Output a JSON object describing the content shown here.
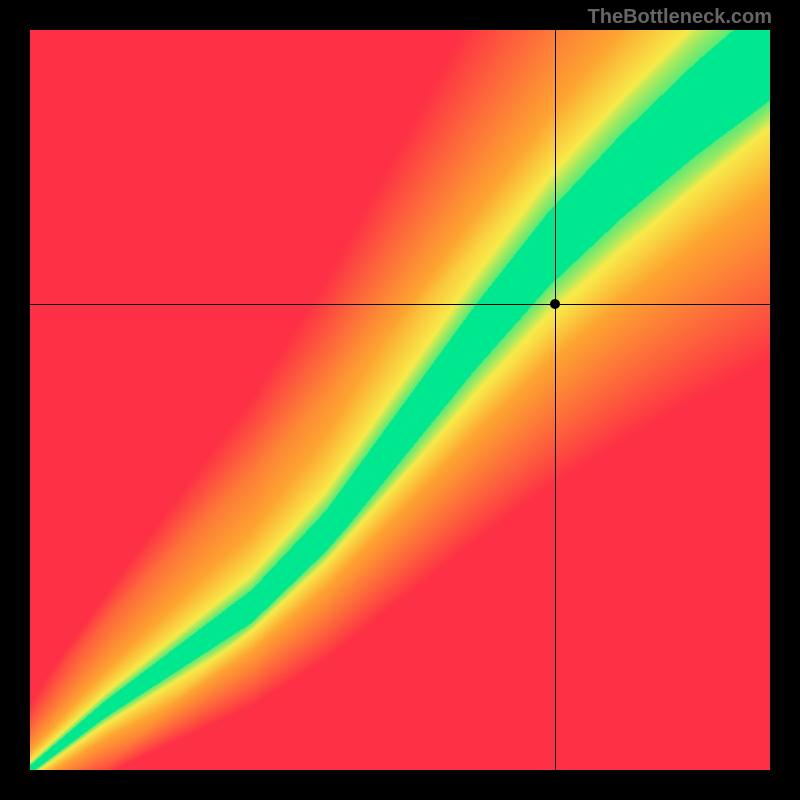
{
  "watermark": "TheBottleneck.com",
  "chart_data": {
    "type": "heatmap",
    "title": "",
    "xlabel": "",
    "ylabel": "",
    "xlim": [
      0,
      100
    ],
    "ylim": [
      0,
      100
    ],
    "crosshair": {
      "x": 71,
      "y": 63
    },
    "marker": {
      "x": 71,
      "y": 63
    },
    "ridge_path_comment": "Green optimal ridge runs diagonally; values are (x_percent, y_percent from bottom-left). Color field: green near ridge, through yellow/orange to red away from it.",
    "ridge": [
      {
        "x": 0,
        "y": 0
      },
      {
        "x": 10,
        "y": 8
      },
      {
        "x": 20,
        "y": 15
      },
      {
        "x": 30,
        "y": 22
      },
      {
        "x": 40,
        "y": 32
      },
      {
        "x": 50,
        "y": 45
      },
      {
        "x": 60,
        "y": 58
      },
      {
        "x": 70,
        "y": 70
      },
      {
        "x": 80,
        "y": 80
      },
      {
        "x": 90,
        "y": 89
      },
      {
        "x": 100,
        "y": 97
      }
    ],
    "colors": {
      "ridge": "#00E88F",
      "near": "#F8EB4A",
      "mid": "#FDA531",
      "far": "#FE3045"
    }
  }
}
